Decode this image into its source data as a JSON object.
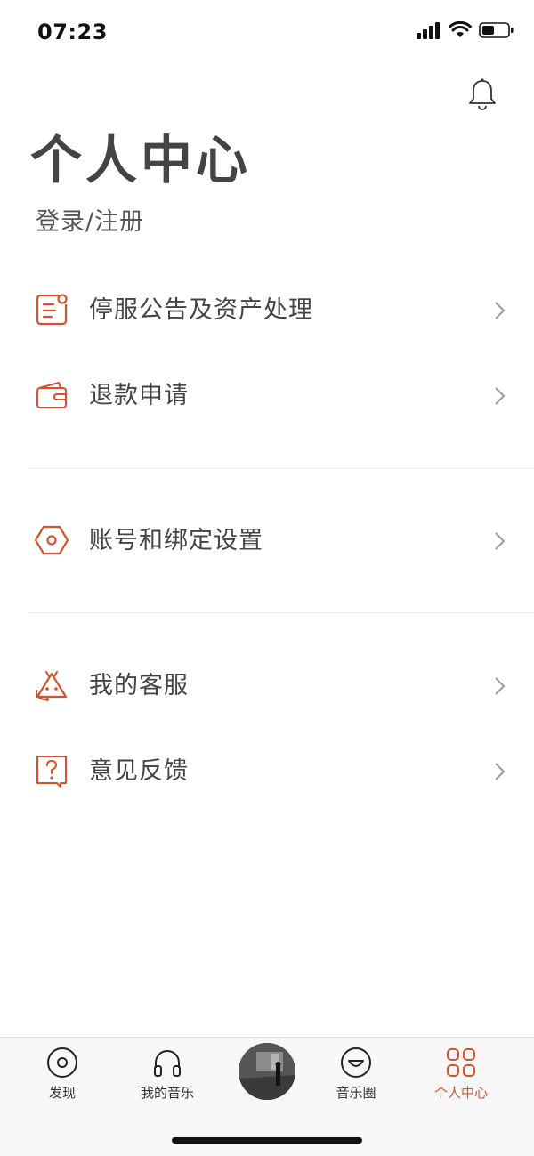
{
  "status_bar": {
    "time": "07:23",
    "icons": [
      "signal-icon",
      "wifi-icon",
      "battery-icon"
    ]
  },
  "header": {
    "title": "个人中心",
    "login_label": "登录/注册",
    "bell_icon": "bell-icon"
  },
  "menu": {
    "groups": [
      [
        {
          "label": "停服公告及资产处理",
          "icon": "announcement-icon"
        },
        {
          "label": "退款申请",
          "icon": "wallet-icon"
        }
      ],
      [
        {
          "label": "账号和绑定设置",
          "icon": "hexagon-settings-icon"
        }
      ],
      [
        {
          "label": "我的客服",
          "icon": "customer-service-icon"
        },
        {
          "label": "意见反馈",
          "icon": "feedback-question-icon"
        }
      ]
    ]
  },
  "tab_bar": {
    "tabs": [
      {
        "label": "发现",
        "icon": "disc-icon",
        "active": false
      },
      {
        "label": "我的音乐",
        "icon": "headphones-icon",
        "active": false
      },
      {
        "label": "",
        "icon": "now-playing-cover",
        "active": false
      },
      {
        "label": "音乐圈",
        "icon": "smile-face-icon",
        "active": false
      },
      {
        "label": "个人中心",
        "icon": "grid-icon",
        "active": true
      }
    ]
  },
  "colors": {
    "accent": "#d4532e",
    "text_primary": "#444444",
    "chevron": "#9a9a9a",
    "divider": "#ececec",
    "tabbar_bg": "#f7f7f7"
  }
}
